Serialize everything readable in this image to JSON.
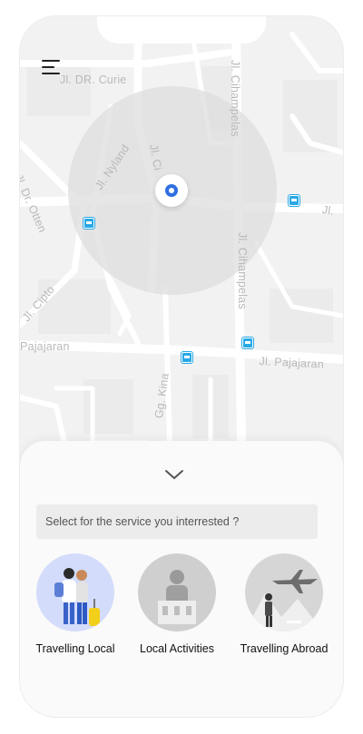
{
  "map": {
    "streets": [
      "Jl. DR. Curie",
      "Jl. Dr. Otten",
      "Jl. Nyland",
      "Jl. Ci",
      "Jl. Cihampelas",
      "Jl. Cihampelas",
      "Jl.",
      "Jl. Cipto",
      "Pajajaran",
      "Jl. Pajajaran",
      "Gg. Kina"
    ]
  },
  "colors": {
    "pin": "#2f6fe0",
    "bus_stop": "#29a8e8",
    "panel": "#fafafa",
    "search_bg": "#ececec"
  },
  "sheet": {
    "search_placeholder": "Select for the service you interrested ?",
    "services": [
      {
        "label": "Travelling Local"
      },
      {
        "label": "Local Activities"
      },
      {
        "label": "Travelling Abroad"
      }
    ]
  }
}
